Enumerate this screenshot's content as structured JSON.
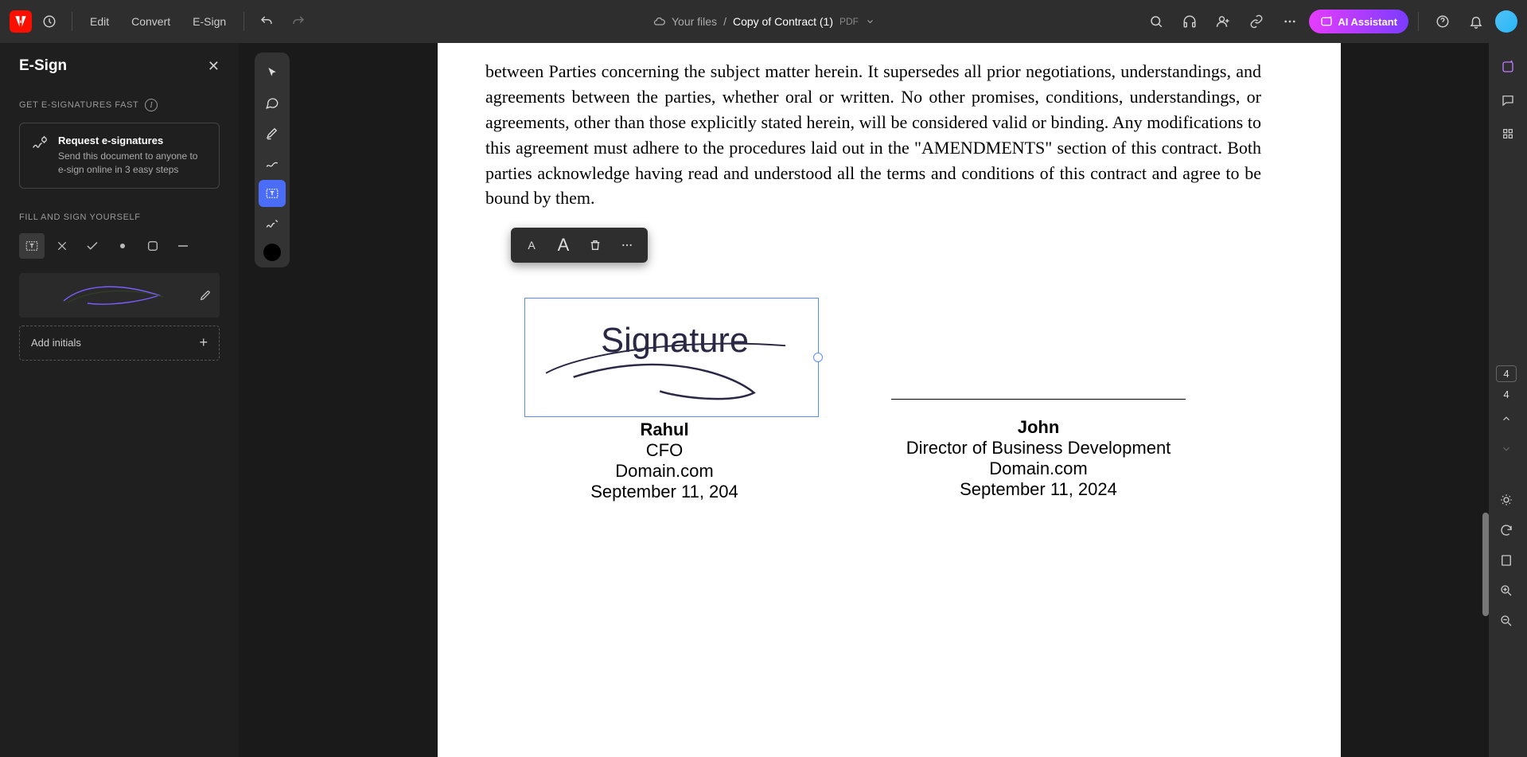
{
  "topbar": {
    "edit": "Edit",
    "convert": "Convert",
    "esign": "E-Sign",
    "breadcrumb_root": "Your files",
    "breadcrumb_current": "Copy of Contract (1)",
    "file_type": "PDF",
    "ai_label": "AI Assistant"
  },
  "left": {
    "panel_title": "E-Sign",
    "section_get": "GET E-SIGNATURES FAST",
    "request_title": "Request e-signatures",
    "request_desc": "Send this document to anyone to e-sign online in 3 easy steps",
    "section_fill": "FILL AND SIGN YOURSELF",
    "add_initials": "Add initials"
  },
  "mini": {
    "small": "A",
    "big": "A"
  },
  "doc": {
    "paragraph": "between Parties concerning the subject matter herein. It supersedes all prior negotiations, understandings, and agreements between the parties, whether oral or written. No other promises, conditions, understandings, or agreements, other than those explicitly stated herein, will be considered valid or binding. Any modifications to this agreement must adhere to the procedures laid out in the \"AMENDMENTS\" section of this contract. Both parties acknowledge having read and understood all the terms and conditions of this contract and agree to be bound by them.",
    "sig_word": "Signature",
    "sign1": {
      "name": "Rahul",
      "role": "CFO",
      "domain": "Domain.com",
      "date": "September 11, 204"
    },
    "sign2": {
      "name": "John",
      "role": "Director of Business Development",
      "domain": "Domain.com",
      "date": "September 11, 2024"
    }
  },
  "pagenav": {
    "page_box": "4",
    "page_total": "4"
  }
}
